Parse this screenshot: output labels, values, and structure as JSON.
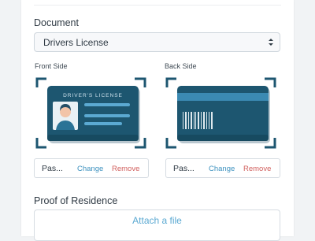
{
  "document_section": {
    "label": "Document",
    "select_value": "Drivers License"
  },
  "front": {
    "side_label": "Front Side",
    "card_title": "DRIVER'S LICENSE",
    "file_name": "Pas...",
    "change_label": "Change",
    "remove_label": "Remove"
  },
  "back": {
    "side_label": "Back Side",
    "file_name": "Pas...",
    "change_label": "Change",
    "remove_label": "Remove"
  },
  "residence_section": {
    "label": "Proof of Residence",
    "attach_label": "Attach a file"
  },
  "colors": {
    "card_dark": "#1d5670",
    "card_mid": "#2a7396",
    "accent_blue": "#3c91bf",
    "remove_red": "#d1605e"
  }
}
